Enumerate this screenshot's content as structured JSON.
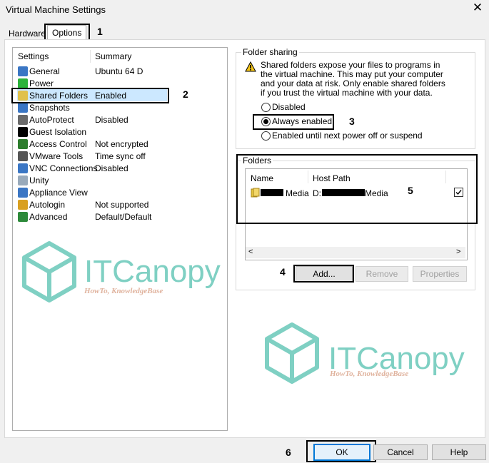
{
  "window": {
    "title": "Virtual Machine Settings",
    "close_glyph": "✕"
  },
  "tabs": [
    {
      "label": "Hardware"
    },
    {
      "label": "Options"
    }
  ],
  "settings_list": {
    "col_settings": "Settings",
    "col_summary": "Summary",
    "items": [
      {
        "label": "General",
        "summary": "Ubuntu 64 D",
        "icon": "monitor-icon"
      },
      {
        "label": "Power",
        "summary": "",
        "icon": "play-icon"
      },
      {
        "label": "Shared Folders",
        "summary": "Enabled",
        "icon": "folder-icon"
      },
      {
        "label": "Snapshots",
        "summary": "",
        "icon": "snapshot-icon"
      },
      {
        "label": "AutoProtect",
        "summary": "Disabled",
        "icon": "clock-icon"
      },
      {
        "label": "Guest Isolation",
        "summary": "",
        "icon": "lock-icon"
      },
      {
        "label": "Access Control",
        "summary": "Not encrypted",
        "icon": "key-icon"
      },
      {
        "label": "VMware Tools",
        "summary": "Time sync off",
        "icon": "vm-icon"
      },
      {
        "label": "VNC Connections",
        "summary": "Disabled",
        "icon": "screen-icon"
      },
      {
        "label": "Unity",
        "summary": "",
        "icon": "unity-icon"
      },
      {
        "label": "Appliance View",
        "summary": "",
        "icon": "window-icon"
      },
      {
        "label": "Autologin",
        "summary": "Not supported",
        "icon": "user-key-icon"
      },
      {
        "label": "Advanced",
        "summary": "Default/Default",
        "icon": "chart-icon"
      }
    ]
  },
  "folder_sharing": {
    "group_label": "Folder sharing",
    "warning": "Shared folders expose your files to programs in the virtual machine. This may put your computer and your data at risk. Only enable shared folders if you trust the virtual machine with your data.",
    "options": [
      {
        "label": "Disabled",
        "selected": false
      },
      {
        "label": "Always enabled",
        "selected": true
      },
      {
        "label": "Enabled until next power off or suspend",
        "selected": false
      }
    ]
  },
  "folders": {
    "group_label": "Folders",
    "col_name": "Name",
    "col_host_path": "Host Path",
    "rows": [
      {
        "name_suffix": "Media",
        "host_path_prefix": "D:",
        "host_path_suffix": "Media",
        "checked": true
      }
    ],
    "scroll_left": "<",
    "scroll_right": ">",
    "add_label": "Add...",
    "remove_label": "Remove",
    "properties_label": "Properties"
  },
  "footer": {
    "ok_label": "OK",
    "cancel_label": "Cancel",
    "help_label": "Help"
  },
  "annotations": [
    "1",
    "2",
    "3",
    "4",
    "5",
    "6"
  ],
  "watermark": {
    "brand": "ITCanopy",
    "tagline": "HowTo, KnowledgeBase"
  },
  "colors": {
    "selection": "#cce8ff",
    "watermark": "#7fd0c3",
    "tagline": "#e0b39e",
    "ok_border": "#0078d7"
  }
}
